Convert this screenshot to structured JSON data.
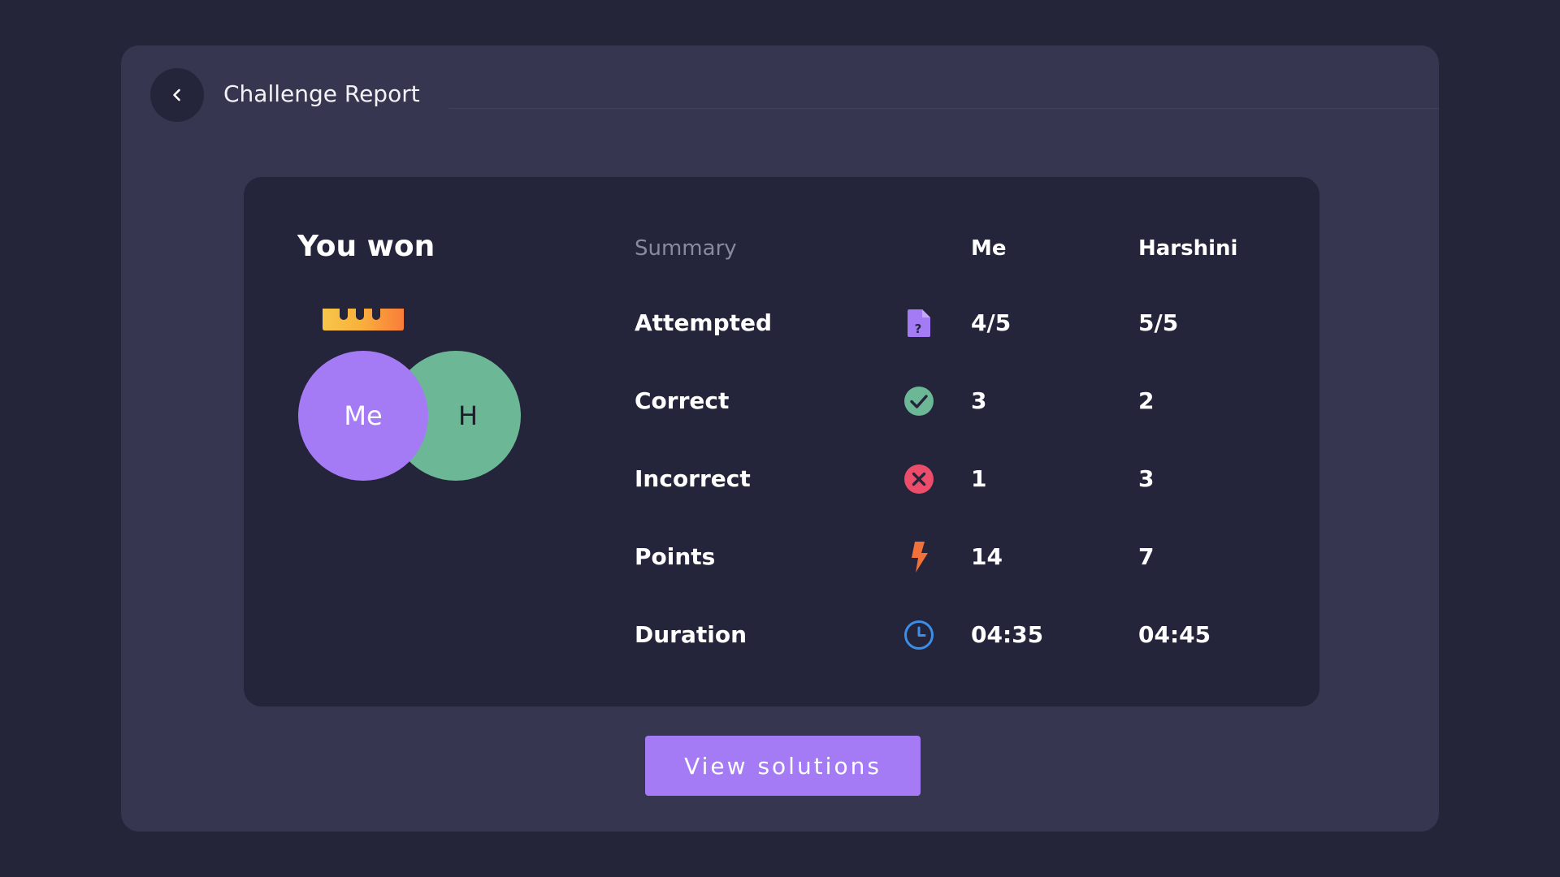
{
  "header": {
    "title": "Challenge Report",
    "back_icon": "chevron-left-icon"
  },
  "result": {
    "title": "You won",
    "crown_icon": "crown-icon",
    "me_avatar": "Me",
    "opponent_avatar": "H",
    "colors": {
      "me": "#a57bf5",
      "opponent": "#6bb796"
    }
  },
  "summary": {
    "headers": {
      "label": "Summary",
      "me": "Me",
      "opponent": "Harshini"
    },
    "rows": [
      {
        "label": "Attempted",
        "icon": "question-file-icon",
        "me": "4/5",
        "opponent": "5/5"
      },
      {
        "label": "Correct",
        "icon": "check-circle-icon",
        "me": "3",
        "opponent": "2"
      },
      {
        "label": "Incorrect",
        "icon": "cross-circle-icon",
        "me": "1",
        "opponent": "3"
      },
      {
        "label": "Points",
        "icon": "lightning-icon",
        "me": "14",
        "opponent": "7"
      },
      {
        "label": "Duration",
        "icon": "clock-icon",
        "me": "04:35",
        "opponent": "04:45"
      }
    ]
  },
  "actions": {
    "view_solutions": "View solutions"
  }
}
